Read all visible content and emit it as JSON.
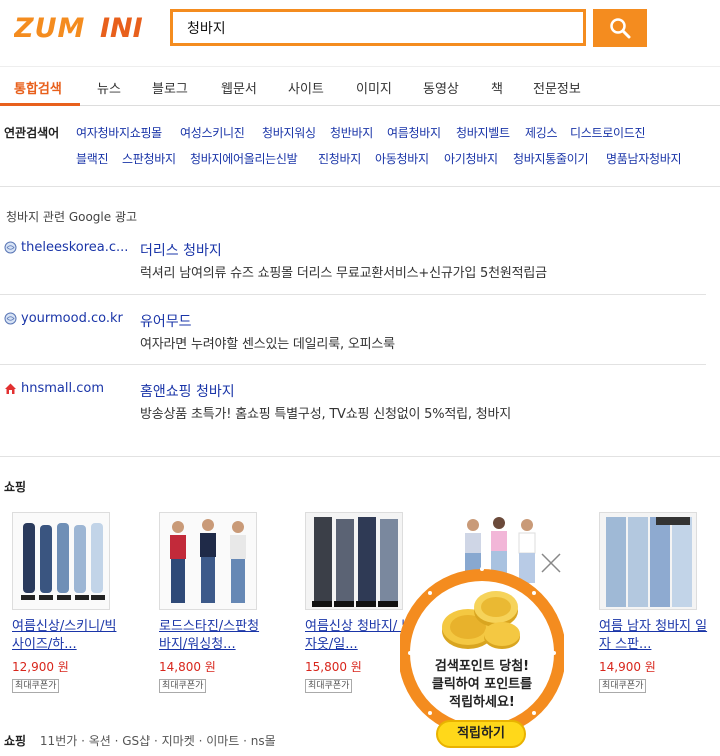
{
  "header": {
    "logo_text": "ZUMINI",
    "search_value": "청바지",
    "brand_color": "#f48c1f"
  },
  "tabs": [
    "통합검색",
    "뉴스",
    "블로그",
    "웹문서",
    "사이트",
    "이미지",
    "동영상",
    "책",
    "전문정보"
  ],
  "related": {
    "title": "연관검색어",
    "row1": [
      "여자청바지쇼핑몰",
      "여성스키니진",
      "청바지워싱",
      "청반바지",
      "여름청바지",
      "청바지벨트",
      "제깅스",
      "디스트로이드진"
    ],
    "row2": [
      "블랙진",
      "스판청바지",
      "청바지에어올리는신발",
      "진청바지",
      "아동청바지",
      "아기청바지",
      "청바지통줄이기",
      "명품남자청바지"
    ]
  },
  "ads": {
    "title": "청바지 관련 Google 광고",
    "items": [
      {
        "domain": "theleeskorea.c...",
        "headline": "더리스 청바지",
        "desc": "럭셔리 남여의류 슈즈 쇼핑몰 더리스 무료교환서비스+신규가입 5천원적립금",
        "icon": "globe-icon"
      },
      {
        "domain": "yourmood.co.kr",
        "headline": "유어무드",
        "desc": "여자라면 누려야할 센스있는 데일리룩, 오피스룩",
        "icon": "globe-icon"
      },
      {
        "domain": "hnsmall.com",
        "headline": "홈앤쇼핑 청바지",
        "desc": "방송상품 초특가! 홈쇼핑 특별구성, TV쇼핑 신청없이 5%적립, 청바지",
        "icon": "home-icon"
      }
    ]
  },
  "shopping": {
    "title": "쇼핑",
    "products": [
      {
        "name": "여름신상/스키니/빅사이즈/하...",
        "price": "12,900 원",
        "coupon": "최대쿠폰가"
      },
      {
        "name": "로드스타진/스판청바지/워싱청...",
        "price": "14,800 원",
        "coupon": "최대쿠폰가"
      },
      {
        "name": "여름신상 청바지/ 남자옷/일...",
        "price": "15,800 원",
        "coupon": "최대쿠폰가"
      },
      {
        "name": "",
        "price": "",
        "coupon": ""
      },
      {
        "name": "여름 남자 청바지 일자 스판...",
        "price": "14,900 원",
        "coupon": "최대쿠폰가"
      }
    ],
    "footer_label": "쇼핑",
    "footer_stores": "11번가 · 옥션 · GS샵 · 지마켓 · 이마트 · ns몰"
  },
  "popup": {
    "line1": "검색포인트 당첨!",
    "line2": "클릭하여 포인트를",
    "line3": "적립하세요!",
    "button": "적립하기"
  }
}
